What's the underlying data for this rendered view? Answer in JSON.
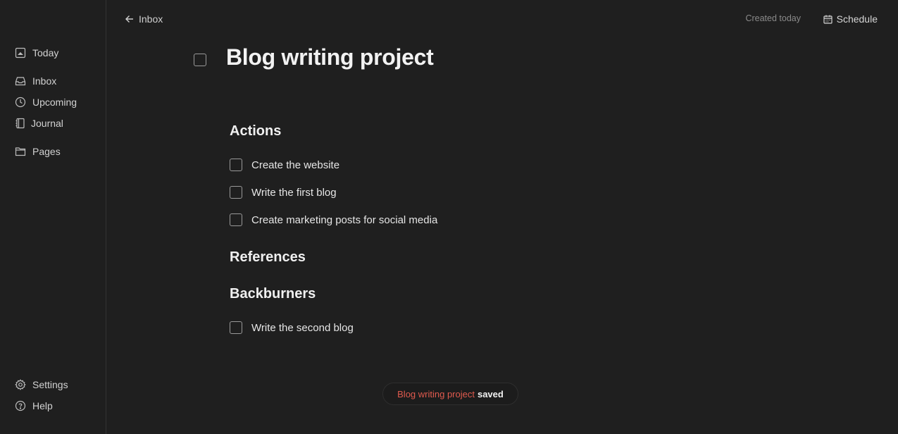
{
  "sidebar": {
    "today": {
      "label": "Today",
      "icon": "today-icon"
    },
    "inbox": {
      "label": "Inbox",
      "icon": "inbox-icon"
    },
    "upcoming": {
      "label": "Upcoming",
      "icon": "clock-icon"
    },
    "journal": {
      "label": "Journal",
      "icon": "journal-icon"
    },
    "pages": {
      "label": "Pages",
      "icon": "folder-icon"
    },
    "settings": {
      "label": "Settings",
      "icon": "gear-icon"
    },
    "help": {
      "label": "Help",
      "icon": "help-icon"
    }
  },
  "topbar": {
    "back_label": "Inbox",
    "created": "Created today",
    "schedule_label": "Schedule"
  },
  "page": {
    "title": "Blog writing project",
    "sections": [
      {
        "heading": "Actions",
        "tasks": [
          "Create the website",
          "Write the first blog",
          "Create marketing posts for social media"
        ]
      },
      {
        "heading": "References",
        "tasks": []
      },
      {
        "heading": "Backburners",
        "tasks": [
          "Write the second blog"
        ]
      }
    ]
  },
  "toast": {
    "name": "Blog writing project",
    "status": "saved"
  },
  "colors": {
    "background": "#1f1f1f",
    "accent": "#e05a4e"
  }
}
